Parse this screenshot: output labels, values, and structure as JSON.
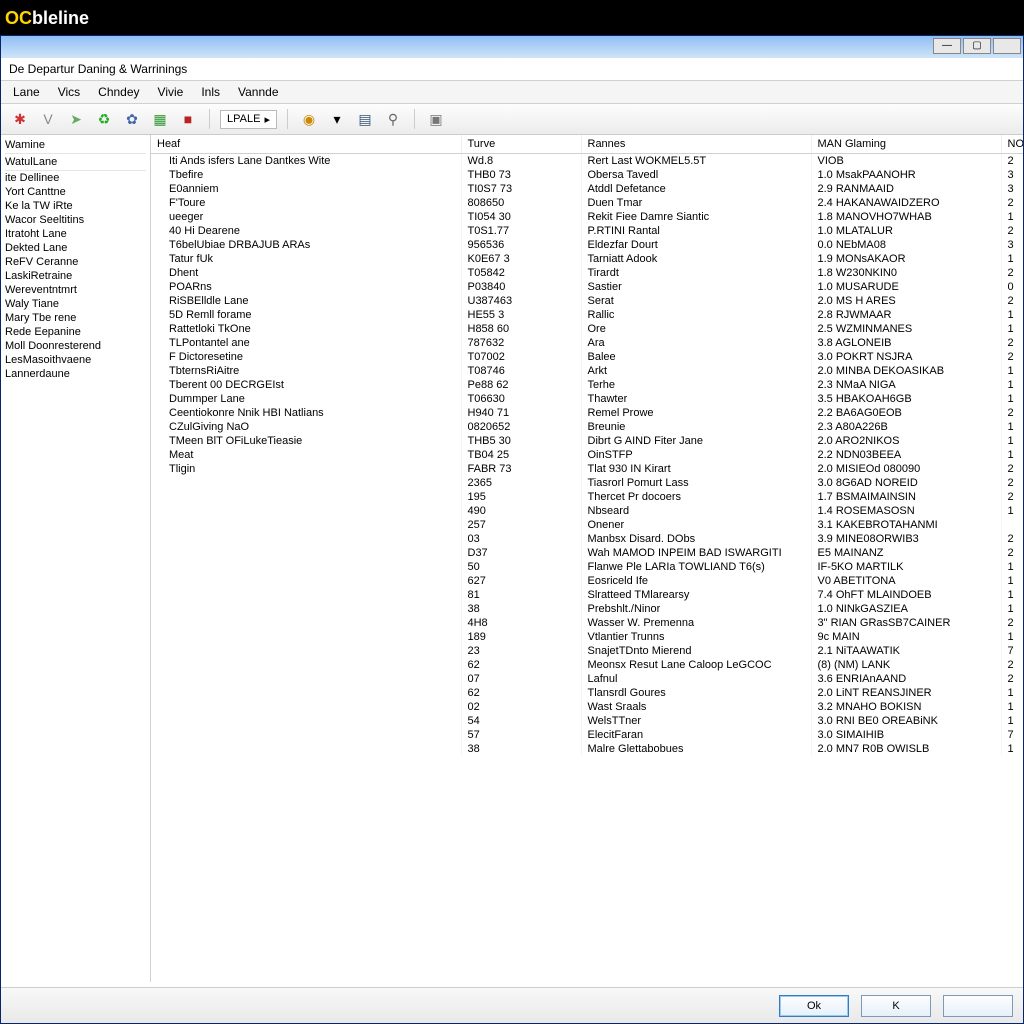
{
  "app": {
    "name_prefix": "OC",
    "name_suffix": "bleline"
  },
  "window": {
    "subtitle": "De Departur Daning & Warrinings",
    "controls": {
      "minimize": "—",
      "maximize": "▢",
      "close": ""
    }
  },
  "menu": [
    "Lane",
    "Vics",
    "Chndey",
    "Vivie",
    "Inls",
    "Vannde"
  ],
  "toolbar": {
    "play_group_label": "LPALE",
    "icons": [
      "bug",
      "check",
      "right-arrow",
      "refresh",
      "gear",
      "cube",
      "stop"
    ],
    "right_icons": [
      "coin",
      "down-caret",
      "calc",
      "pin",
      "frame"
    ]
  },
  "tree": {
    "headers": [
      "Wamine",
      "WatulLane"
    ],
    "items": [
      "ite Dellinee",
      "Yort Canttne",
      "Ke la TW iRte",
      "Wacor Seeltitins",
      "Itratoht Lane",
      "Dekted Lane",
      "ReFV Ceranne",
      "LaskiRetraine",
      "Wereventntmrt",
      "Waly Tiane",
      "Mary Tbe rene",
      "Rede Eepanine",
      "Moll Doonresterend",
      "LesMasoithvaene",
      "Lannerdaune"
    ]
  },
  "columns": {
    "c1": "Heaf",
    "c2": "Turve",
    "c3": "Rannes",
    "c4": "MAN Glaming",
    "c5": "NOISE"
  },
  "rows": [
    {
      "a": "Iti Ands isfers Lane Dantkes Wite",
      "b": "Wd.8",
      "c": "Rert Last WOKMEL5.5T",
      "d": "VIOB",
      "e": "2"
    },
    {
      "a": "Tbefire",
      "b": "THB0 73",
      "c": "Obersa Tavedl",
      "d": "1.0 MsakPAANOHR",
      "e": "3"
    },
    {
      "a": "E0anniem",
      "b": "TI0S7 73",
      "c": "Atddl Defetance",
      "d": "2.9 RANMAAID",
      "e": "3"
    },
    {
      "a": "F'Toure",
      "b": "808650",
      "c": "Duen Tmar",
      "d": "2.4 HAKANAWAIDZERO",
      "e": "2"
    },
    {
      "a": "ueeger",
      "b": "TI054 30",
      "c": "Rekit Fiee Damre Siantic",
      "d": "1.8 MANOVHO7WHAB",
      "e": "1"
    },
    {
      "a": "40 Hi Dearene",
      "b": "T0S1.77",
      "c": "P.RTINI Rantal",
      "d": "1.0 MLATALUR",
      "e": "2"
    },
    {
      "a": "T6belUbiae DRBAJUB ARAs",
      "b": "956536",
      "c": "Eldezfar Dourt",
      "d": "0.0 NEbMA08",
      "e": "3"
    },
    {
      "a": "Tatur fUk",
      "b": "K0E67 3",
      "c": "Tarniatt Adook",
      "d": "1.9 MONsAKAOR",
      "e": "1"
    },
    {
      "a": "Dhent",
      "b": "T05842",
      "c": "Tirardt",
      "d": "1.8 W230NKIN0",
      "e": "2"
    },
    {
      "a": "POARns",
      "b": "P03840",
      "c": "Sastier",
      "d": "1.0 MUSARUDE",
      "e": "0"
    },
    {
      "a": "RiSBElldle Lane",
      "b": "U387463",
      "c": "Serat",
      "d": "2.0 MS H ARES",
      "e": "2"
    },
    {
      "a": "5D Remll forame",
      "b": "HE55 3",
      "c": "Rallic",
      "d": "2.8 RJWMAAR",
      "e": "1"
    },
    {
      "a": "Rattetloki TkOne",
      "b": "H858 60",
      "c": "Ore",
      "d": "2.5 WZMINMANES",
      "e": "1"
    },
    {
      "a": "TLPontantel ane",
      "b": "787632",
      "c": "Ara",
      "d": "3.8 AGLONEIB",
      "e": "2"
    },
    {
      "a": "F Dictoresetine",
      "b": "T07002",
      "c": "Balee",
      "d": "3.0 POKRT NSJRA",
      "e": "2"
    },
    {
      "a": "TbternsRiAitre",
      "b": "T08746",
      "c": "Arkt",
      "d": "2.0 MINBA DEKOASIKAB",
      "e": "1"
    },
    {
      "a": "Tberent 00 DECRGEIst",
      "b": "Pe88 62",
      "c": "Terhe",
      "d": "2.3 NMaA NIGA",
      "e": "1"
    },
    {
      "a": "Dummper Lane",
      "b": "T06630",
      "c": "Thawter",
      "d": "3.5 HBAKOAH6GB",
      "e": "1"
    },
    {
      "a": "Ceentiokonre Nnik HBI Natlians",
      "b": "H940 71",
      "c": "Remel Prowe",
      "d": "2.2 BA6AG0EOB",
      "e": "2"
    },
    {
      "a": "CZulGiving NaO",
      "b": "0820652",
      "c": "Breunie",
      "d": "2.3 A80A226B",
      "e": "1"
    },
    {
      "a": "TMeen BlT OFiLukeTieasie",
      "b": "THB5 30",
      "c": "Dibrt G AIND Fiter Jane",
      "d": "2.0 ARO2NIKOS",
      "e": "1"
    },
    {
      "a": "Meat",
      "b": "TB04 25",
      "c": "OinSTFP",
      "d": "2.2 NDN03BEEA",
      "e": "1"
    },
    {
      "a": "Tligin",
      "b": "FABR 73",
      "c": "Tlat 930 IN Kirart",
      "d": "2.0 MISIEOd 080090",
      "e": "2"
    },
    {
      "a": "",
      "b": "2365",
      "c": "Tiasrorl Pomurt Lass",
      "d": "3.0 8G6AD NOREID",
      "e": "2"
    },
    {
      "a": "",
      "b": "195",
      "c": "Thercet Pr docoers",
      "d": "1.7 BSMAIMAINSIN",
      "e": "2"
    },
    {
      "a": "",
      "b": "490",
      "c": "Nbseard",
      "d": "1.4 ROSEMASOSN",
      "e": "1"
    },
    {
      "a": "",
      "b": "257",
      "c": "Onener",
      "d": "3.1 KAKEBROTAHANMI",
      "e": ""
    },
    {
      "a": "",
      "b": "03",
      "c": "Manbsx Disard. DObs",
      "d": "3.9 MINE08ORWIB3",
      "e": "2"
    },
    {
      "a": "",
      "b": "D37",
      "c": "Wah MAMOD INPEIM BAD ISWARGITI",
      "d": "E5 MAINANZ",
      "e": "2"
    },
    {
      "a": "",
      "b": "50",
      "c": "Flanwe Ple LARIa TOWLIAND T6(s)",
      "d": "IF-5KO MARTILK",
      "e": "1"
    },
    {
      "a": "",
      "b": "627",
      "c": "Eosriceld Ife",
      "d": "V0 ABETITONA",
      "e": "1"
    },
    {
      "a": "",
      "b": "81",
      "c": "Slratteed TMlarearsy",
      "d": "7.4 OhFT MLAINDOEB",
      "e": "1"
    },
    {
      "a": "",
      "b": "38",
      "c": "Prebshlt./Ninor",
      "d": "1.0 NINkGASZIEA",
      "e": "1"
    },
    {
      "a": "",
      "b": "4H8",
      "c": "Wasser W. Premenna",
      "d": "3\" RIAN GRasSB7CAINER",
      "e": "2"
    },
    {
      "a": "",
      "b": "189",
      "c": "Vtlantier Trunns",
      "d": "9c MAIN",
      "e": "1"
    },
    {
      "a": "",
      "b": "23",
      "c": "SnajetTDnto Mierend",
      "d": "2.1 NiTAAWATIK",
      "e": "7"
    },
    {
      "a": "",
      "b": "62",
      "c": "Meonsx Resut Lane Caloop LeGCOC",
      "d": "(8) (NM) LANK",
      "e": "2"
    },
    {
      "a": "",
      "b": "07",
      "c": "Lafnul",
      "d": "3.6 ENRIAnAAND",
      "e": "2"
    },
    {
      "a": "",
      "b": "62",
      "c": "Tlansrdl Goures",
      "d": "2.0 LiNT REANSJINER",
      "e": "1"
    },
    {
      "a": "",
      "b": "02",
      "c": "Wast Sraals",
      "d": "3.2 MNAHO BOKISN",
      "e": "1"
    },
    {
      "a": "",
      "b": "54",
      "c": "WelsTTner",
      "d": "3.0 RNI BE0 OREABiNK",
      "e": "1"
    },
    {
      "a": "",
      "b": "57",
      "c": "ElecitFaran",
      "d": "3.0 SIMAIHIB",
      "e": "7"
    },
    {
      "a": "",
      "b": "38",
      "c": "Malre Glettabobues",
      "d": "2.0 MN7 R0B OWISLB",
      "e": "1"
    }
  ],
  "footer": {
    "ok": "Ok",
    "k": "K",
    "extra": ""
  }
}
